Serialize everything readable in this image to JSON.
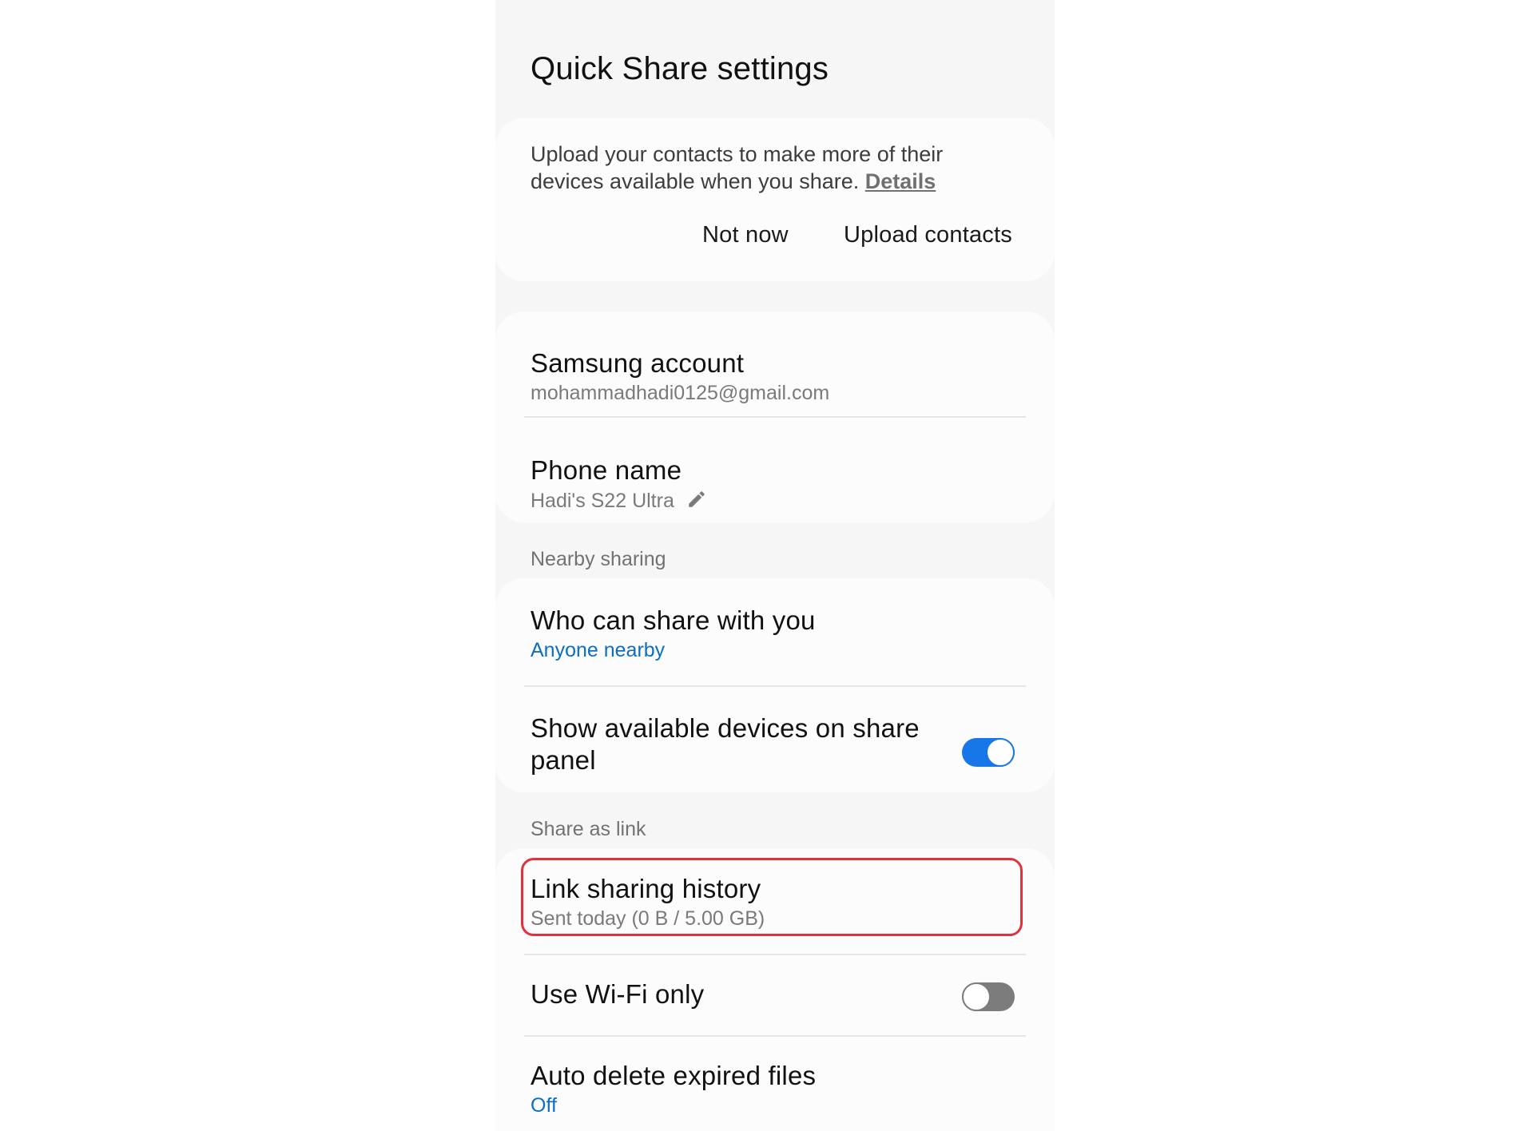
{
  "header": {
    "title": "Quick Share settings"
  },
  "upload_card": {
    "message": "Upload your contacts to make more of their devices available when you share.",
    "details_link": "Details",
    "not_now_label": "Not now",
    "upload_label": "Upload contacts"
  },
  "account_card": {
    "samsung_account": {
      "title": "Samsung account",
      "email": "mohammadhadi0125@gmail.com"
    },
    "phone_name": {
      "title": "Phone name",
      "value": "Hadi's S22 Ultra",
      "icon": "pencil-icon"
    }
  },
  "nearby_sharing": {
    "header": "Nearby sharing",
    "who_can_share": {
      "title": "Who can share with you",
      "value": "Anyone nearby"
    },
    "show_devices": {
      "title_line1": "Show available devices on share",
      "title_line2": "panel",
      "enabled": true
    }
  },
  "share_as_link": {
    "header": "Share as link",
    "link_history": {
      "title": "Link sharing history",
      "subtitle": "Sent today (0 B / 5.00 GB)"
    },
    "wifi_only": {
      "title": "Use Wi-Fi only",
      "enabled": false
    },
    "auto_delete": {
      "title": "Auto delete expired files",
      "value": "Off"
    }
  },
  "colors": {
    "accent": "#1877e8",
    "link_blue": "#0a6fc2",
    "highlight_red": "#e0323c",
    "background": "#f6f6f6",
    "card": "#fcfcfc"
  }
}
